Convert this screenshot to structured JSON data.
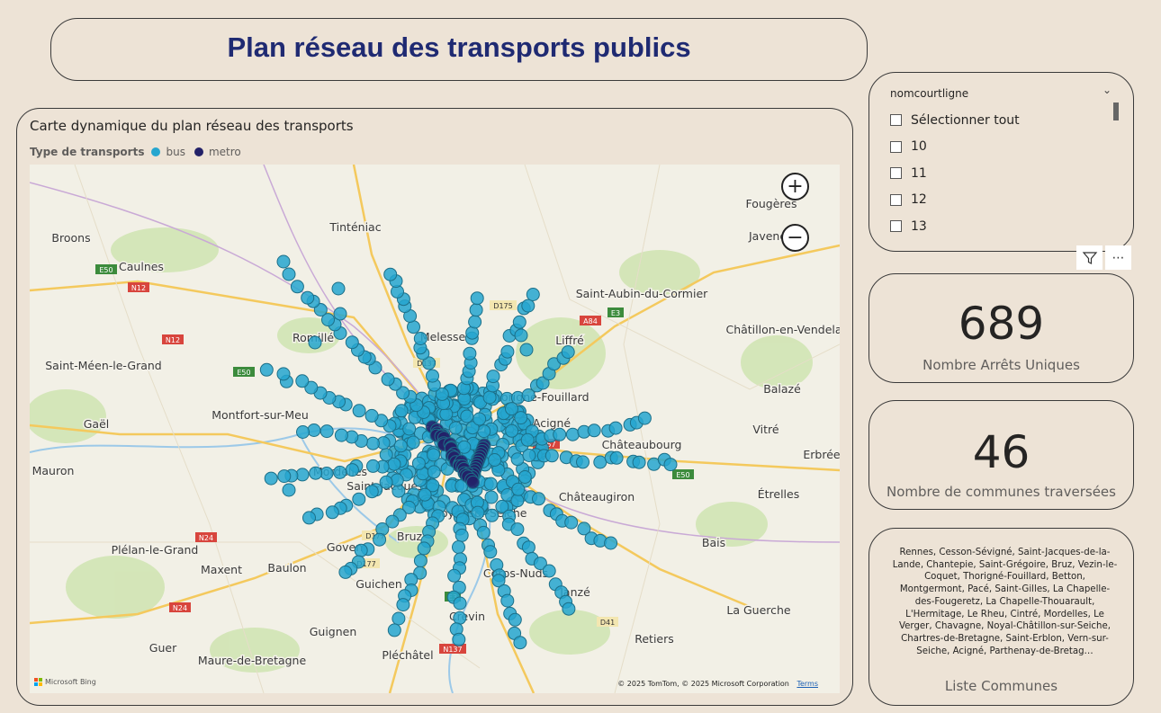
{
  "page": {
    "title": "Plan réseau des transports publics"
  },
  "map_visual": {
    "title": "Carte dynamique du plan réseau des transports",
    "legend": {
      "title": "Type de transports",
      "items": [
        {
          "label": "bus",
          "color": "#26a6cf"
        },
        {
          "label": "metro",
          "color": "#232168"
        }
      ]
    },
    "zoom_in": "+",
    "zoom_out": "−",
    "credit": "© 2025 TomTom, © 2025 Microsoft Corporation",
    "terms": "Terms",
    "provider": "Microsoft Bing",
    "place_labels": [
      "Fougères",
      "Javene",
      "Tinténiac",
      "Broons",
      "Caulnes",
      "Saint-Aubin-du-Cormier",
      "Romillé",
      "Melesse",
      "Liffré",
      "Châtillon-en-Vendela",
      "Saint-Méen-le-Grand",
      "Balazé",
      "Thorigné-Fouillard",
      "Acigné",
      "Gaël",
      "Montfort-sur-Meu",
      "Vitré",
      "Châteaubourg",
      "Erbrée",
      "Mauron",
      "Mordelles",
      "Saint-Jacques",
      "Châteaugiron",
      "Étrelles",
      "Noyal-sur-Seiche",
      "Goven",
      "Bruz",
      "Bais",
      "Plélan-le-Grand",
      "Maxent",
      "Baulon",
      "Guichen",
      "Corps-Nuds",
      "Janzé",
      "Crevin",
      "La Guerche",
      "Guignen",
      "Retiers",
      "Guer",
      "Maure-de-Bretagne",
      "Pléchâtel"
    ],
    "road_labels": [
      "E50",
      "N12",
      "N12",
      "E50",
      "D137",
      "D175",
      "A84",
      "E3",
      "N157",
      "E50",
      "N24",
      "D177",
      "D177",
      "E3",
      "N24",
      "D41",
      "N137"
    ]
  },
  "slicer": {
    "header": "nomcourtligne",
    "items": [
      "Sélectionner tout",
      "10",
      "11",
      "12",
      "13"
    ]
  },
  "visual_tools": {
    "filter_icon": "filter-icon",
    "more_icon": "more-options-icon"
  },
  "kpis": {
    "arrets": {
      "value": "689",
      "label": "Nombre Arrêts Uniques"
    },
    "communes": {
      "value": "46",
      "label": "Nombre de communes traversées"
    }
  },
  "communes_list": {
    "text": "Rennes, Cesson-Sévigné, Saint-Jacques-de-la-Lande, Chantepie, Saint-Grégoire, Bruz, Vezin-le-Coquet, Thorigné-Fouillard, Betton, Montgermont, Pacé, Saint-Gilles, La Chapelle-des-Fougeretz, La Chapelle-Thouarault, L'Hermitage, Le Rheu, Cintré, Mordelles, Le Verger, Chavagne, Noyal-Châtillon-sur-Seiche, Chartres-de-Bretagne, Saint-Erblon, Vern-sur-Seiche, Acigné, Parthenay-de-Bretag…",
    "label": "Liste Communes"
  }
}
